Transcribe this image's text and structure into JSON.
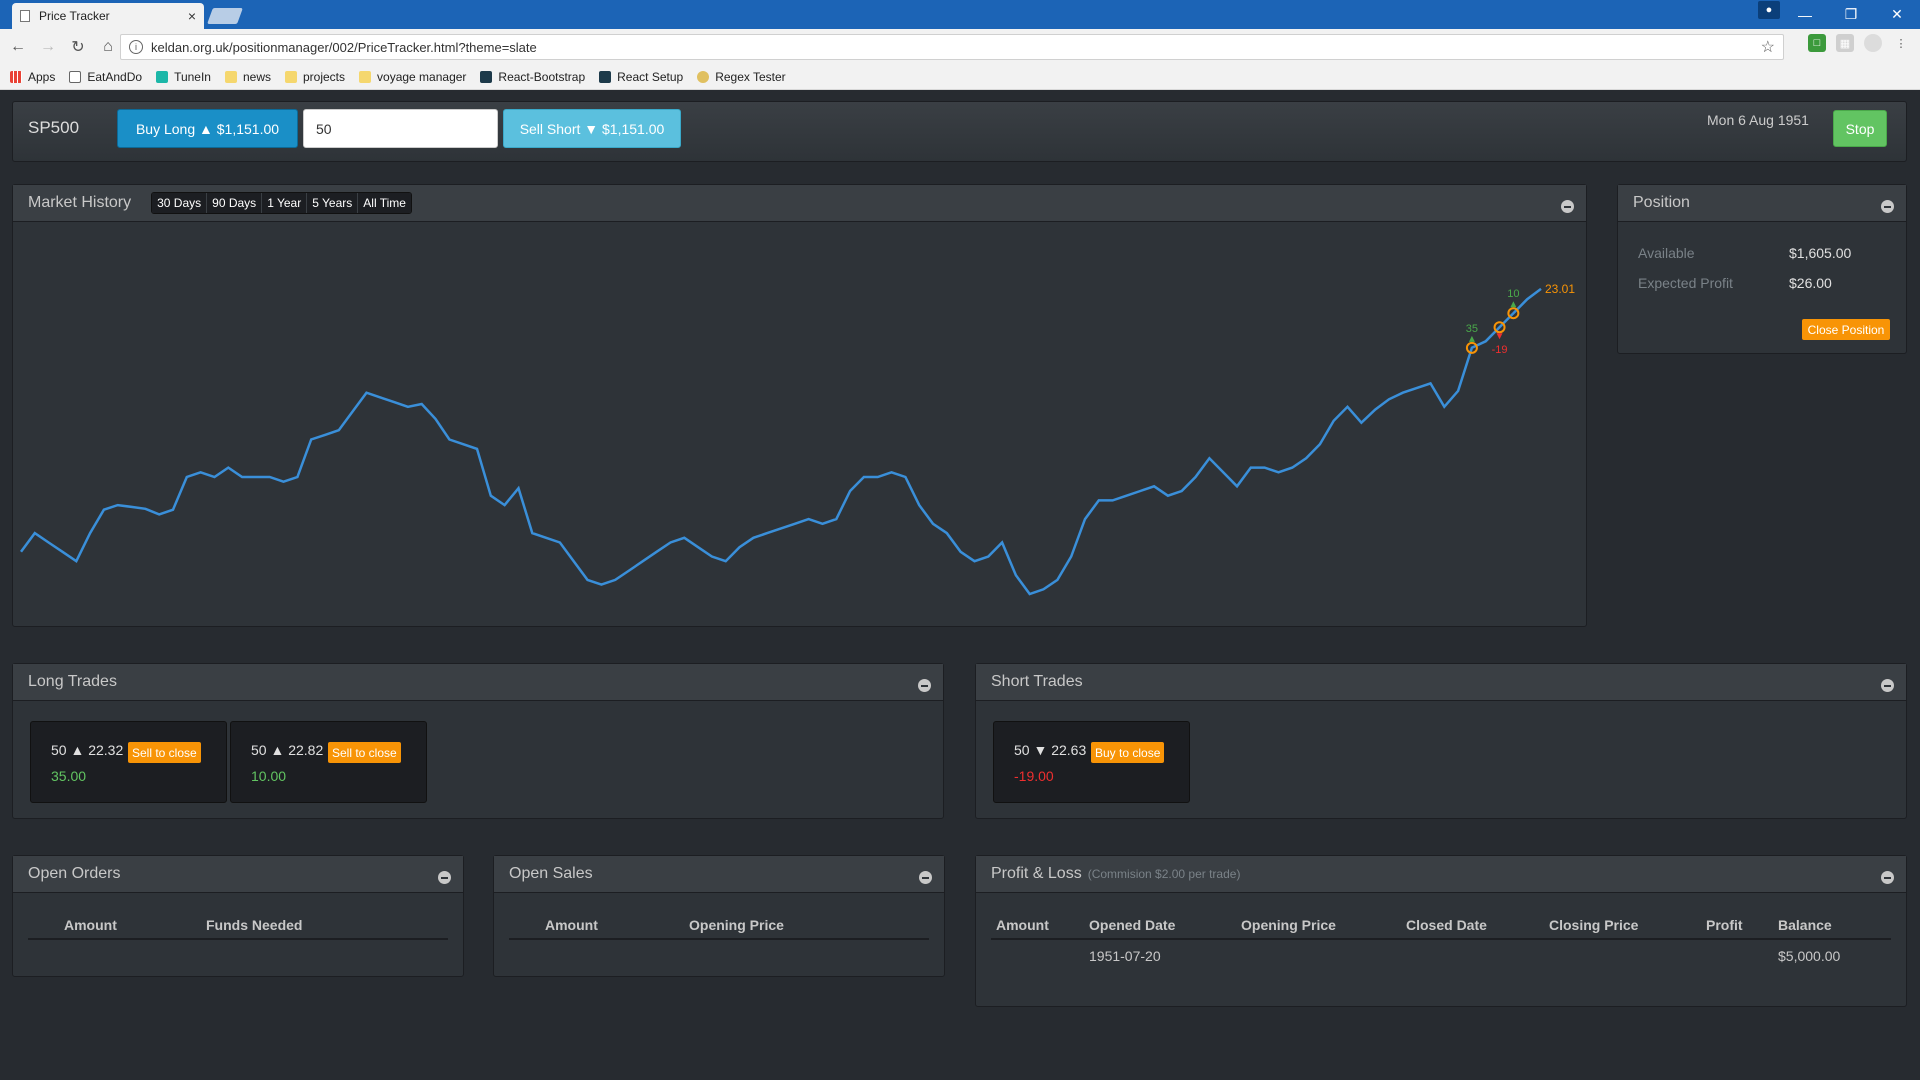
{
  "browser": {
    "tab_title": "Price Tracker",
    "tab_close": "×",
    "url": "keldan.org.uk/positionmanager/002/PriceTracker.html?theme=slate",
    "bookmarks": [
      "Apps",
      "EatAndDo",
      "TuneIn",
      "news",
      "projects",
      "voyage manager",
      "React-Bootstrap",
      "React Setup",
      "Regex Tester"
    ]
  },
  "topbar": {
    "symbol": "SP500",
    "buy_label": "Buy Long ▲ $1,151.00",
    "quantity": "50",
    "sell_label": "Sell Short ▼ $1,151.00",
    "date": "Mon 6 Aug 1951",
    "stop_label": "Stop"
  },
  "history": {
    "title": "Market History",
    "ranges": [
      "30 Days",
      "90 Days",
      "1 Year",
      "5 Years",
      "All Time"
    ],
    "last_price_label": "23.01",
    "markers": [
      {
        "label": "35",
        "type": "long"
      },
      {
        "label": "-19",
        "type": "short"
      },
      {
        "label": "10",
        "type": "long"
      }
    ]
  },
  "chart_data": {
    "type": "line",
    "series": [
      {
        "values": [
          20.2,
          20.4,
          20.3,
          20.2,
          20.1,
          20.4,
          20.65,
          20.7,
          20.68,
          20.66,
          20.6,
          20.65,
          21.0,
          21.05,
          21.0,
          21.1,
          21.0,
          21.0,
          21.0,
          20.95,
          21.0,
          21.4,
          21.45,
          21.5,
          21.7,
          21.9,
          21.85,
          21.8,
          21.75,
          21.78,
          21.62,
          21.4,
          21.35,
          21.3,
          20.8,
          20.7,
          20.88,
          20.4,
          20.35,
          20.3,
          20.1,
          19.9,
          19.85,
          19.9,
          20.0,
          20.1,
          20.2,
          20.3,
          20.35,
          20.25,
          20.15,
          20.1,
          20.25,
          20.35,
          20.4,
          20.45,
          20.5,
          20.55,
          20.5,
          20.55,
          20.85,
          21.0,
          21.0,
          21.05,
          21.0,
          20.7,
          20.5,
          20.4,
          20.2,
          20.1,
          20.15,
          20.3,
          19.95,
          19.75,
          19.8,
          19.9,
          20.15,
          20.55,
          20.75,
          20.75,
          20.8,
          20.85,
          20.9,
          20.8,
          20.85,
          21.0,
          21.2,
          21.05,
          20.9,
          21.1,
          21.1,
          21.05,
          21.1,
          21.2,
          21.35,
          21.6,
          21.75,
          21.58,
          21.72,
          21.83,
          21.9,
          21.95,
          22.0,
          21.75,
          21.92,
          22.38,
          22.45,
          22.6,
          22.75,
          22.9,
          23.01
        ]
      }
    ],
    "trade_points": [
      {
        "value": 22.32,
        "label": "35"
      },
      {
        "value": 22.63,
        "label": "-19"
      },
      {
        "value": 22.82,
        "label": "10"
      }
    ],
    "ylim": [
      19.6,
      23.5
    ],
    "grid": false
  },
  "position": {
    "title": "Position",
    "available_label": "Available",
    "available_value": "$1,605.00",
    "profit_label": "Expected Profit",
    "profit_value": "$26.00",
    "close_label": "Close Position"
  },
  "long_trades": {
    "title": "Long Trades",
    "cards": [
      {
        "line": "50 ▲ 22.32",
        "button": "Sell to close",
        "pnl": "35.00"
      },
      {
        "line": "50 ▲ 22.82",
        "button": "Sell to close",
        "pnl": "10.00"
      }
    ]
  },
  "short_trades": {
    "title": "Short Trades",
    "cards": [
      {
        "line": "50 ▼ 22.63",
        "button": "Buy to close",
        "pnl": "-19.00"
      }
    ]
  },
  "open_orders": {
    "title": "Open Orders",
    "columns": [
      "Amount",
      "Funds Needed"
    ]
  },
  "open_sales": {
    "title": "Open Sales",
    "columns": [
      "Amount",
      "Opening Price"
    ]
  },
  "profit_loss": {
    "title": "Profit & Loss",
    "note": "(Commision $2.00 per trade)",
    "columns": [
      "Amount",
      "Opened Date",
      "Opening Price",
      "Closed Date",
      "Closing Price",
      "Profit",
      "Balance"
    ],
    "rows": [
      [
        "",
        "1951-07-20",
        "",
        "",
        "",
        "",
        "$5,000.00"
      ]
    ]
  },
  "colors": {
    "line": "#3a8fd9",
    "marker": "#f89406",
    "long": "#4aa94a",
    "short": "#ee2f2f"
  }
}
